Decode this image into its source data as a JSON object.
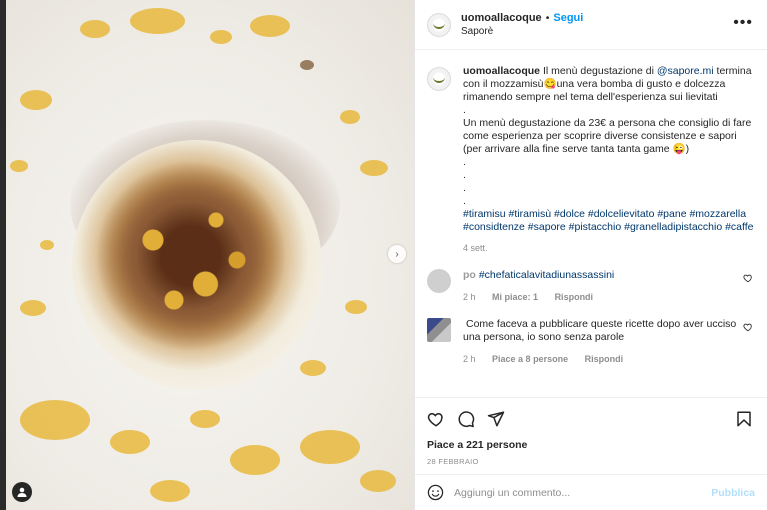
{
  "post": {
    "username": "uomoallacoque",
    "follow_label": "Segui",
    "location": "Saporè"
  },
  "caption": {
    "username": "uomoallacoque",
    "line1_pre": "Il menù degustazione di ",
    "line1_mention": "@sapore.mi",
    "line1_post": " termina con il mozzamisù😋una vera bomba di gusto e dolcezza rimanendo sempre nel tema dell'esperienza sui lievitati",
    "dot": ".",
    "para2": "Un menù degustazione da 23€ a persona che consiglio di fare come esperienza per scoprire diverse consistenze e sapori (per arrivare alla fine serve tanta tanta game 😜)",
    "hashtags": "#tiramisu #tiramisù #dolce #dolcelievitato #pane #mozzarella #considtenze #sapore #pistacchio #granelladipistacchio #caffe",
    "time": "4 sett."
  },
  "comments": [
    {
      "user": "po",
      "text": "#chefaticalavitadiunassassini",
      "time": "2 h",
      "likes": "Mi piace: 1",
      "reply": "Rispondi"
    },
    {
      "user": "",
      "text": "Come faceva a pubblicare queste ricette dopo aver ucciso una persona, io sono senza parole",
      "time": "2 h",
      "likes": "Piace a 8 persone",
      "reply": "Rispondi"
    }
  ],
  "footer": {
    "likes": "Piace a 221 persone",
    "date": "28 FEBBRAIO",
    "comment_placeholder": "Aggiungi un commento...",
    "publish_label": "Pubblica"
  },
  "colors": {
    "link": "#00376b",
    "follow": "#0095f6",
    "publish_disabled": "#b2dffc",
    "muted": "#8e8e8e"
  },
  "icons": [
    "heart-icon",
    "comment-icon",
    "share-icon",
    "bookmark-icon",
    "emoji-icon",
    "more-icon",
    "chevron-right-icon",
    "user-tag-icon"
  ]
}
